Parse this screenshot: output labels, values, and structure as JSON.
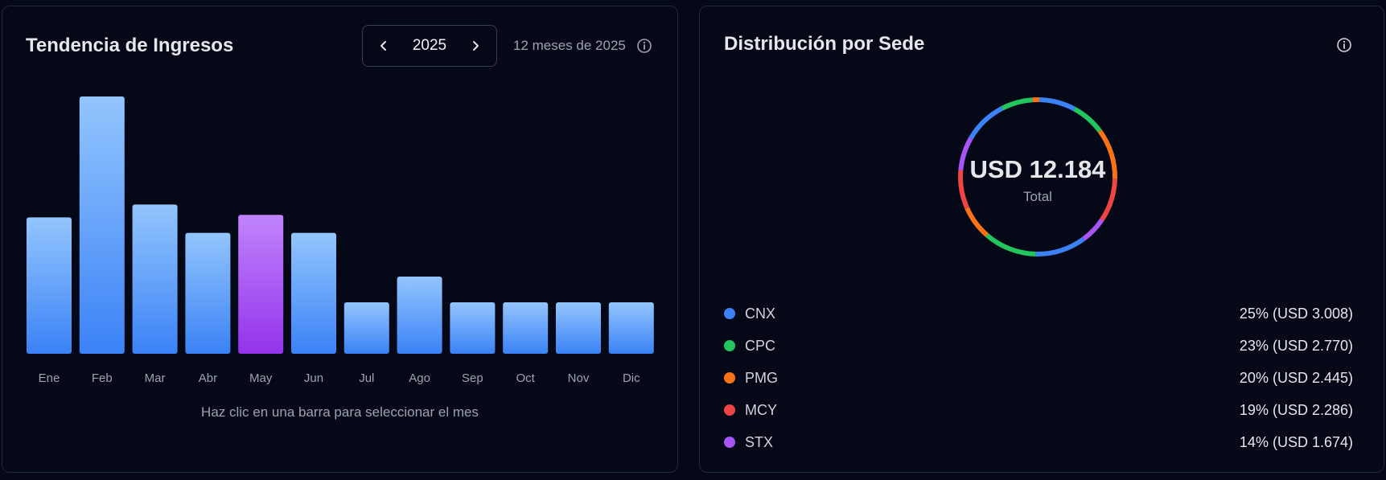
{
  "revenue_card": {
    "title": "Tendencia de Ingresos",
    "year": "2025",
    "subtitle": "12 meses de 2025",
    "hint": "Haz clic en una barra para seleccionar el mes"
  },
  "distribution_card": {
    "title": "Distribución por Sede",
    "total": "USD 12.184",
    "total_caption": "Total",
    "legend": [
      {
        "name": "CNX",
        "value": "25% (USD 3.008)",
        "color": "#3b82f6"
      },
      {
        "name": "CPC",
        "value": "23% (USD 2.770)",
        "color": "#22c55e"
      },
      {
        "name": "PMG",
        "value": "20% (USD 2.445)",
        "color": "#f97316"
      },
      {
        "name": "MCY",
        "value": "19% (USD 2.286)",
        "color": "#ef4444"
      },
      {
        "name": "STX",
        "value": "14% (USD 1.674)",
        "color": "#a855f7"
      }
    ]
  },
  "chart_data": [
    {
      "type": "bar",
      "categories": [
        "Ene",
        "Feb",
        "Mar",
        "Abr",
        "May",
        "Jun",
        "Jul",
        "Ago",
        "Sep",
        "Oct",
        "Nov",
        "Dic"
      ],
      "values": [
        53,
        100,
        58,
        47,
        54,
        47,
        20,
        30,
        20,
        20,
        20,
        20
      ],
      "ylim": [
        0,
        100
      ],
      "selected": "May",
      "colors": {
        "bar_top": "#93c5fd",
        "bar_bottom": "#3b82f6",
        "selected_top": "#c084fc",
        "selected_bottom": "#9333ea"
      }
    },
    {
      "type": "pie",
      "variant": "donut",
      "segments": [
        {
          "color": "#f97316",
          "value": 1.5
        },
        {
          "color": "#3b82f6",
          "value": 7.5
        },
        {
          "color": "#22c55e",
          "value": 7
        },
        {
          "color": "#f97316",
          "value": 10.5
        },
        {
          "color": "#ef4444",
          "value": 9
        },
        {
          "color": "#a855f7",
          "value": 5.5
        },
        {
          "color": "#3b82f6",
          "value": 10.5
        },
        {
          "color": "#22c55e",
          "value": 11
        },
        {
          "color": "#f97316",
          "value": 7
        },
        {
          "color": "#ef4444",
          "value": 8
        },
        {
          "color": "#a855f7",
          "value": 7
        },
        {
          "color": "#3b82f6",
          "value": 9
        },
        {
          "color": "#22c55e",
          "value": 6.5
        }
      ]
    }
  ]
}
